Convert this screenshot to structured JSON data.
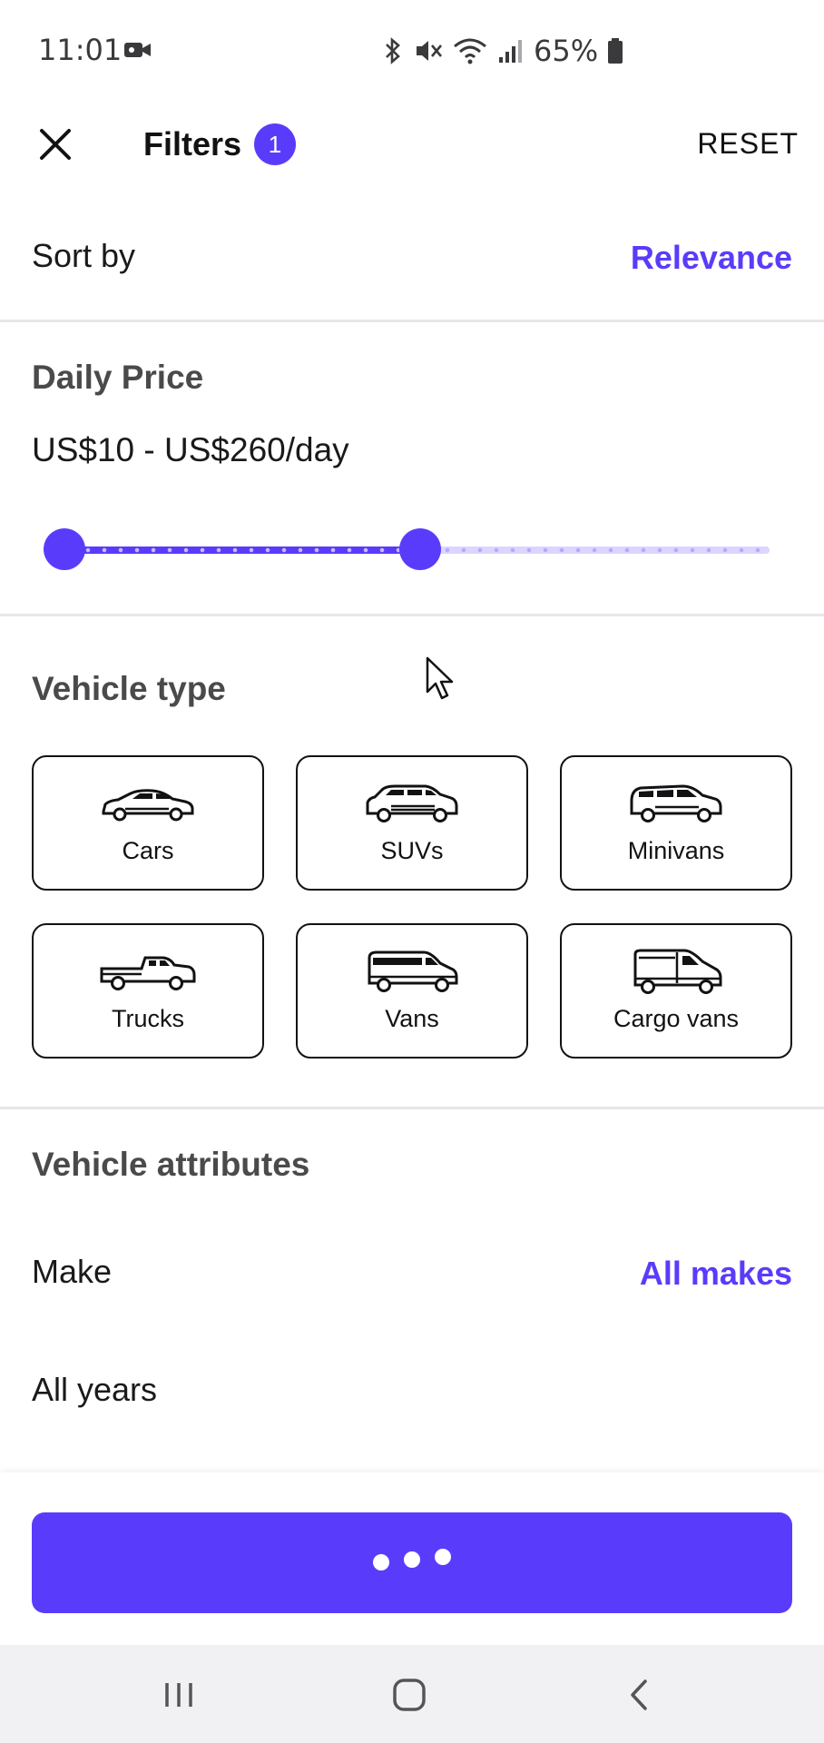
{
  "status_bar": {
    "time": "11:01",
    "battery": "65%",
    "icons": [
      "video-camera-icon",
      "bluetooth-icon",
      "mute-icon",
      "wifi-icon",
      "signal-icon",
      "battery-icon"
    ]
  },
  "header": {
    "title": "Filters",
    "badge_count": "1",
    "reset_label": "RESET"
  },
  "sort": {
    "label": "Sort by",
    "value": "Relevance"
  },
  "daily_price": {
    "title": "Daily Price",
    "range_text": "US$10 - US$260/day",
    "slider_fill_fraction": 0.5
  },
  "vehicle_type": {
    "title": "Vehicle type",
    "options": [
      {
        "label": "Cars",
        "icon": "car-icon"
      },
      {
        "label": "SUVs",
        "icon": "suv-icon"
      },
      {
        "label": "Minivans",
        "icon": "minivan-icon"
      },
      {
        "label": "Trucks",
        "icon": "truck-icon"
      },
      {
        "label": "Vans",
        "icon": "van-icon"
      },
      {
        "label": "Cargo vans",
        "icon": "cargo-van-icon"
      }
    ]
  },
  "vehicle_attributes": {
    "title": "Vehicle attributes",
    "make_label": "Make",
    "make_value": "All makes",
    "years_label": "All years"
  },
  "colors": {
    "accent": "#593cfb",
    "text": "#121214",
    "section_title": "#4a4a4a",
    "divider": "#e6e6ea"
  }
}
